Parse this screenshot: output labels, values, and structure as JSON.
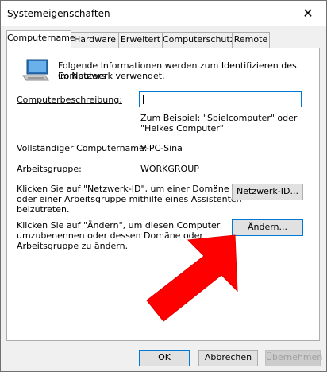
{
  "window": {
    "title": "Systemeigenschaften",
    "close_glyph": "✕"
  },
  "tabs": [
    {
      "label": "Computername"
    },
    {
      "label": "Hardware"
    },
    {
      "label": "Erweitert"
    },
    {
      "label": "Computerschutz"
    },
    {
      "label": "Remote"
    }
  ],
  "panel": {
    "intro_line1": "Folgende Informationen werden zum Identifizieren des Computers",
    "intro_line2": "im Netzwerk verwendet.",
    "description_label": "Computerbeschreibung:",
    "description_value": "",
    "example_line1": "Zum Beispiel: \"Spielcomputer\" oder",
    "example_line2": "\"Heikes Computer\"",
    "fullname_label": "Vollständiger Computername:",
    "fullname_value": "V-PC-Sina",
    "workgroup_label": "Arbeitsgruppe:",
    "workgroup_value": "WORKGROUP",
    "network_text_line1": "Klicken Sie auf \"Netzwerk-ID\", um einer Domäne",
    "network_text_line2": "oder einer Arbeitsgruppe mithilfe eines Assistenten",
    "network_text_line3": "beizutreten.",
    "network_button": "Netzwerk-ID...",
    "change_text_line1": "Klicken Sie auf \"Ändern\", um diesen Computer",
    "change_text_line2": "umzubenennen oder dessen Domäne oder",
    "change_text_line3": "Arbeitsgruppe zu ändern.",
    "change_button": "Ändern..."
  },
  "footer": {
    "ok": "OK",
    "cancel": "Abbrechen",
    "apply": "Übernehmen"
  },
  "colors": {
    "arrow": "#ff0000",
    "focus_border": "#0078d7"
  }
}
